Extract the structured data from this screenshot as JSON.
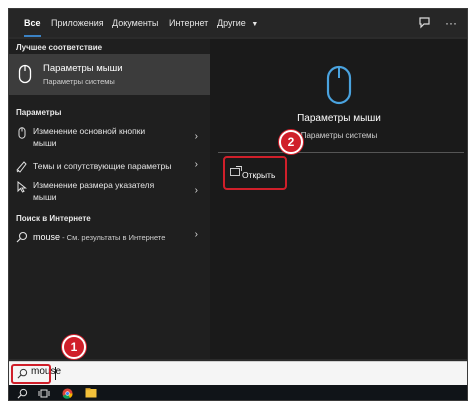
{
  "tabs": [
    {
      "label": "Все",
      "active": true
    },
    {
      "label": "Приложения"
    },
    {
      "label": "Документы"
    },
    {
      "label": "Интернет"
    },
    {
      "label": "Другие"
    }
  ],
  "left": {
    "best_match_header": "Лучшее соответствие",
    "best_match": {
      "title": "Параметры мыши",
      "subtitle": "Параметры системы",
      "icon": "mouse-icon"
    },
    "settings_header": "Параметры",
    "settings_items": [
      {
        "line1": "Изменение основной кнопки",
        "line2": "мыши",
        "icon": "mouse-icon"
      },
      {
        "line1": "Темы и сопутствующие параметры",
        "line2": "",
        "icon": "brush-icon"
      },
      {
        "line1": "Изменение размера указателя",
        "line2": "мыши",
        "icon": "pointer-icon"
      }
    ],
    "web_header": "Поиск в Интернете",
    "web_item": {
      "query": "mouse",
      "suffix": " - См. результаты в Интернете"
    }
  },
  "detail": {
    "title": "Параметры мыши",
    "subtitle": "Параметры системы",
    "open_label": "Открыть"
  },
  "search": {
    "value": "mouse"
  },
  "badges": {
    "one": "1",
    "two": "2"
  },
  "colors": {
    "accent": "#3b82c4",
    "annotation": "#d01f2a",
    "selected": "#3c3c3c"
  }
}
